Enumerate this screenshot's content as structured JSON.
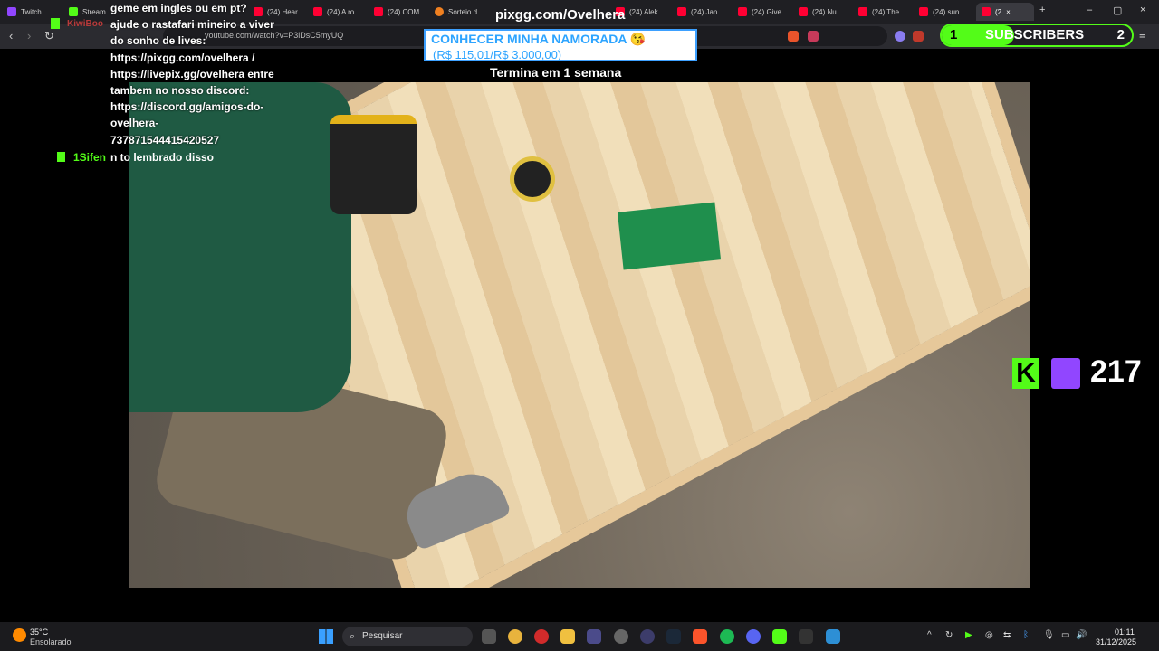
{
  "browser": {
    "tabs": [
      {
        "label": "Twitch",
        "icon": "twitch-icon",
        "color": "#9146ff"
      },
      {
        "label": "Stream",
        "icon": "kick-icon",
        "color": "#53fc18"
      },
      {
        "label": "(24) Hear",
        "icon": "youtube-icon",
        "color": "#ff0033"
      },
      {
        "label": "(24) A ro",
        "icon": "youtube-icon",
        "color": "#ff0033"
      },
      {
        "label": "(24) COM",
        "icon": "youtube-icon",
        "color": "#ff0033"
      },
      {
        "label": "Sorteio d",
        "icon": "orange-icon",
        "color": "#f08020"
      },
      {
        "label": "(24) Alek",
        "icon": "youtube-icon",
        "color": "#ff0033"
      },
      {
        "label": "(24) Jan",
        "icon": "youtube-icon",
        "color": "#ff0033"
      },
      {
        "label": "(24) Give",
        "icon": "youtube-icon",
        "color": "#ff0033"
      },
      {
        "label": "(24) Nu",
        "icon": "youtube-icon",
        "color": "#ff0033"
      },
      {
        "label": "(24) The",
        "icon": "youtube-icon",
        "color": "#ff0033"
      },
      {
        "label": "(24) sun",
        "icon": "youtube-icon",
        "color": "#ff0033"
      },
      {
        "label": "(2",
        "icon": "youtube-icon",
        "color": "#ff0033",
        "active": true
      }
    ],
    "url": "youtube.com/watch?v=P3lDsC5myUQ"
  },
  "overlay": {
    "donation_url": "pixgg.com/Ovelhera",
    "goal_title": "CONHECER MINHA NAMORADA 😘",
    "goal_amount": "(R$ 115,01/R$ 3.000,00)",
    "goal_ends": "Termina em 1 semana",
    "chat": {
      "user1": "KiwiBoo",
      "lines": [
        "geme em ingles ou em pt?",
        "ajude o rastafari mineiro a viver",
        "do sonho de lives:",
        "https://pixgg.com/ovelhera /",
        "https://livepix.gg/ovelhera entre",
        "tambem no nosso discord:",
        "https://discord.gg/amigos-do-",
        "ovelhera-",
        "737871544415420527"
      ],
      "user2": "1Sifen",
      "msg2": "n to lembrado disso"
    },
    "subscribers": {
      "count": "1",
      "label": "SUBSCRIBERS",
      "goal": "2",
      "progress": 0.38,
      "accent": "#53fc18"
    },
    "viewers": {
      "kick_letter": "K",
      "count": "217"
    }
  },
  "taskbar": {
    "weather_temp": "35°C",
    "weather_desc": "Ensolarado",
    "search_label": "Pesquisar",
    "time": "01:11",
    "date": "31/12/2025",
    "apps": [
      "file-icon",
      "chrome-icon",
      "opera-icon",
      "folder-icon",
      "app-icon",
      "github-icon",
      "app2-icon",
      "steam-icon",
      "brave-icon",
      "spotify-icon",
      "discord-icon",
      "play-icon",
      "epic-icon",
      "app3-icon"
    ]
  }
}
